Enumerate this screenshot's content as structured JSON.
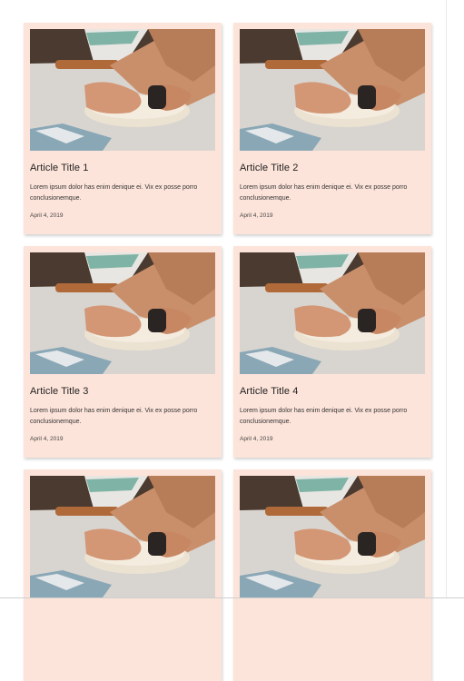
{
  "articles": [
    {
      "title": "Article Title 1",
      "excerpt": "Lorem ipsum dolor has enim denique ei. Vix ex posse porro conclusionemque.",
      "date": "April 4, 2019",
      "image": "dough-kneading-photo"
    },
    {
      "title": "Article Title 2",
      "excerpt": "Lorem ipsum dolor has enim denique ei. Vix ex posse porro conclusionemque.",
      "date": "April 4, 2019",
      "image": "dough-kneading-photo"
    },
    {
      "title": "Article Title 3",
      "excerpt": "Lorem ipsum dolor has enim denique ei. Vix ex posse porro conclusionemque.",
      "date": "April 4, 2019",
      "image": "dough-kneading-photo"
    },
    {
      "title": "Article Title 4",
      "excerpt": "Lorem ipsum dolor has enim denique ei. Vix ex posse porro conclusionemque.",
      "date": "April 4, 2019",
      "image": "dough-kneading-photo"
    },
    {
      "title": "",
      "excerpt": "",
      "date": "",
      "image": "dough-kneading-photo"
    },
    {
      "title": "",
      "excerpt": "",
      "date": "",
      "image": "dough-kneading-photo"
    }
  ],
  "colors": {
    "card_background": "#fde4da",
    "page_background": "#ffffff",
    "text": "#222222"
  }
}
